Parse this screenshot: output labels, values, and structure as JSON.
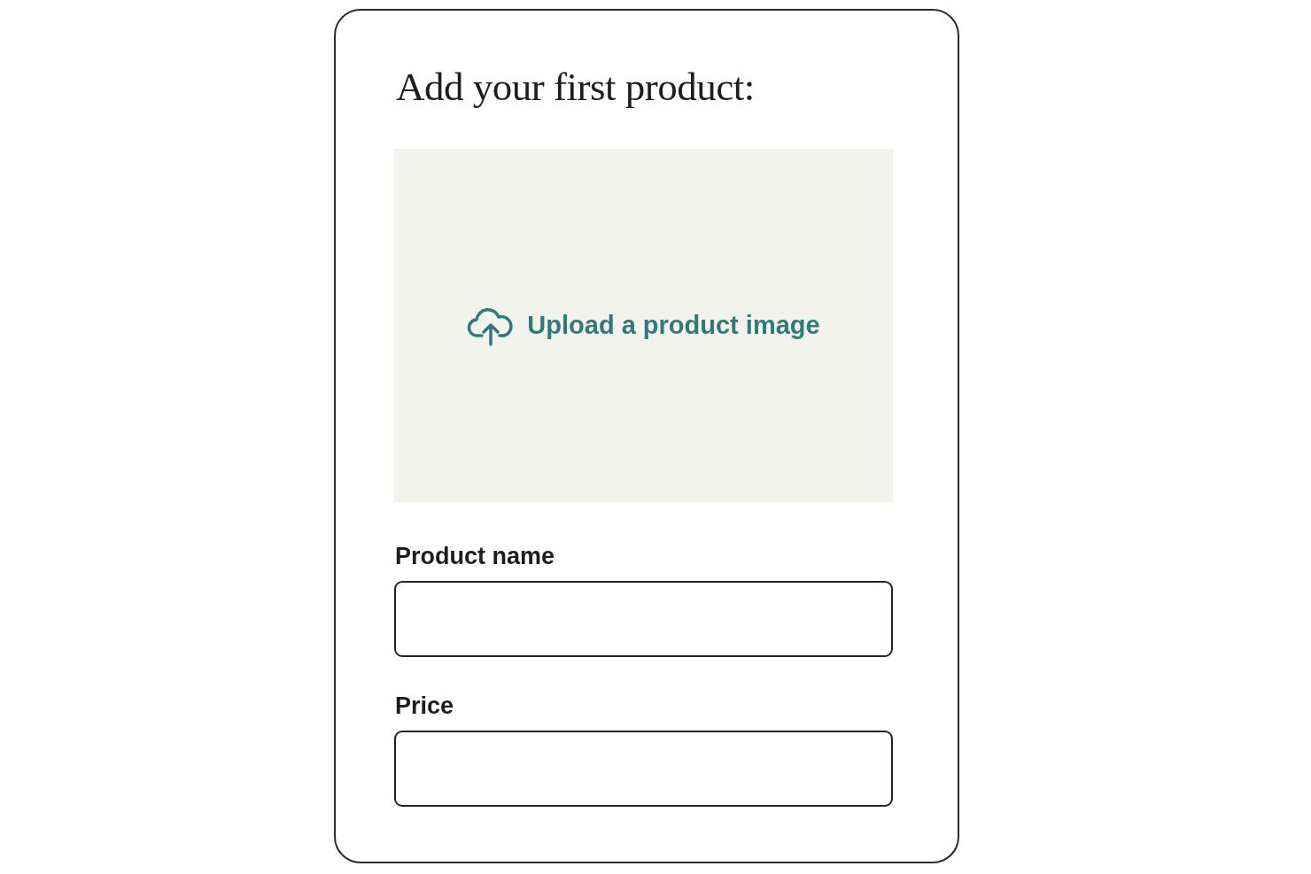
{
  "title": "Add your first product:",
  "upload": {
    "label": "Upload a product image"
  },
  "fields": [
    {
      "label": "Product name"
    },
    {
      "label": "Price"
    }
  ]
}
